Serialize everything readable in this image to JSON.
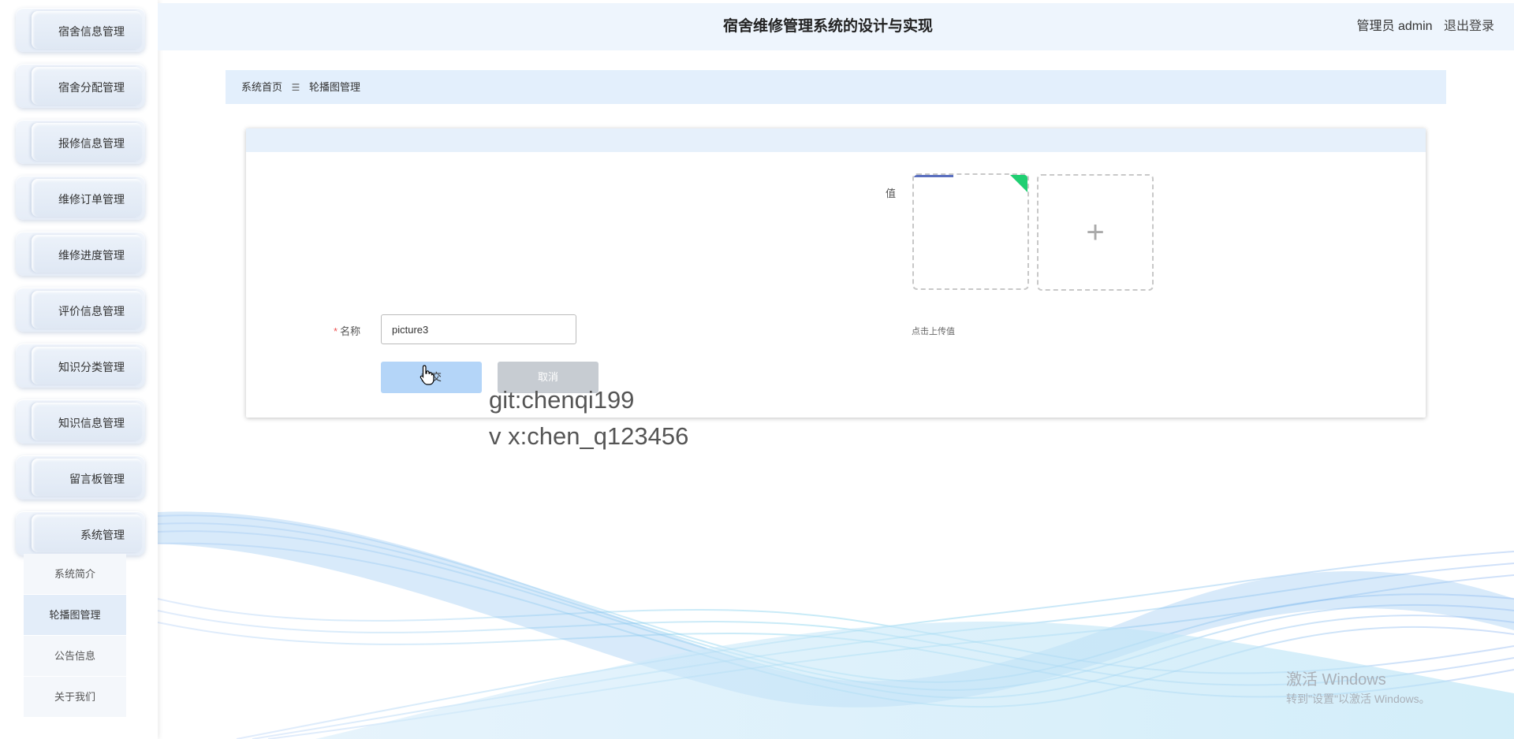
{
  "header": {
    "title": "宿舍维修管理系统的设计与实现",
    "user_label": "管理员 admin",
    "logout_label": "退出登录"
  },
  "sidebar": {
    "items": [
      {
        "label": "宿舍信息管理"
      },
      {
        "label": "宿舍分配管理"
      },
      {
        "label": "报修信息管理"
      },
      {
        "label": "维修订单管理"
      },
      {
        "label": "维修进度管理"
      },
      {
        "label": "评价信息管理"
      },
      {
        "label": "知识分类管理"
      },
      {
        "label": "知识信息管理"
      },
      {
        "label": "留言板管理"
      },
      {
        "label": "系统管理"
      }
    ],
    "submenu": [
      {
        "label": "系统简介"
      },
      {
        "label": "轮播图管理"
      },
      {
        "label": "公告信息"
      },
      {
        "label": "关于我们"
      }
    ]
  },
  "breadcrumb": {
    "home": "系统首页",
    "separator": "☰",
    "current": "轮播图管理"
  },
  "form": {
    "value_label": "值",
    "upload_hint": "点击上传值",
    "name_label": "名称",
    "name_required_mark": "*",
    "name_value": "picture3",
    "submit_label": "提交",
    "cancel_label": "取消",
    "add_icon": "plus-icon"
  },
  "overlay": {
    "line1": "git:chenqi199",
    "line2": "v x:chen_q123456"
  },
  "windows_activation": {
    "line1": "激活 Windows",
    "line2": "转到\"设置\"以激活 Windows。"
  },
  "colors": {
    "header_bg": "#eef5fd",
    "breadcrumb_bg": "#e3effc",
    "submit_bg": "#b4d5f8",
    "cancel_bg": "#c7ccd2",
    "corner_badge": "#1fcf72"
  }
}
